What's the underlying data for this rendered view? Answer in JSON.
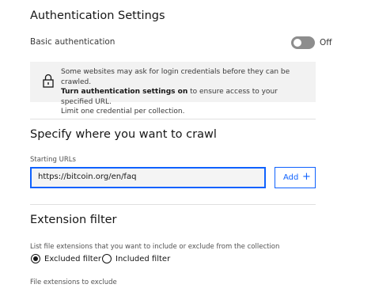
{
  "auth": {
    "title": "Authentication Settings",
    "basic_label": "Basic authentication",
    "toggle_state": "Off",
    "notice_line1": "Some websites may ask for login credentials before they can be crawled.",
    "notice_bold": "Turn authentication settings on",
    "notice_line2_rest": " to ensure access to your specified URL.",
    "notice_line3": "Limit one credential per collection."
  },
  "crawl": {
    "title": "Specify where you want to crawl",
    "starting_urls_label": "Starting URLs",
    "url_value": "https://bitcoin.org/en/faq",
    "add_label": "Add",
    "add_icon": "+"
  },
  "extension": {
    "title": "Extension filter",
    "help": "List file extensions that you want to include or exclude from the collection",
    "options": [
      {
        "label": "Excluded filter",
        "selected": true
      },
      {
        "label": "Included filter",
        "selected": false
      }
    ],
    "exclude_label": "File extensions to exclude"
  },
  "colors": {
    "accent": "#0f62fe",
    "toggle_off": "#8d8d8d",
    "notice_bg": "#f2f2f2"
  }
}
